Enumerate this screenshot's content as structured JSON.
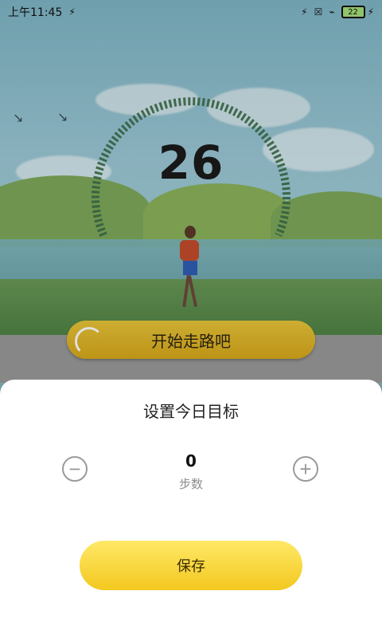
{
  "status_bar": {
    "time": "上午11:45",
    "battery_level": "22"
  },
  "main": {
    "step_count": "26",
    "start_button_label": "开始走路吧"
  },
  "goal_sheet": {
    "title": "设置今日目标",
    "goal_value": "0",
    "unit_label": "步数",
    "save_label": "保存"
  },
  "icons": {
    "minus": "minus-icon",
    "plus": "plus-icon",
    "bluetooth": "bluetooth-icon",
    "wifi": "wifi-icon"
  },
  "colors": {
    "button_yellow": "#f3c81f",
    "start_button": "#d8a91a",
    "gauge": "#3b6b47"
  }
}
